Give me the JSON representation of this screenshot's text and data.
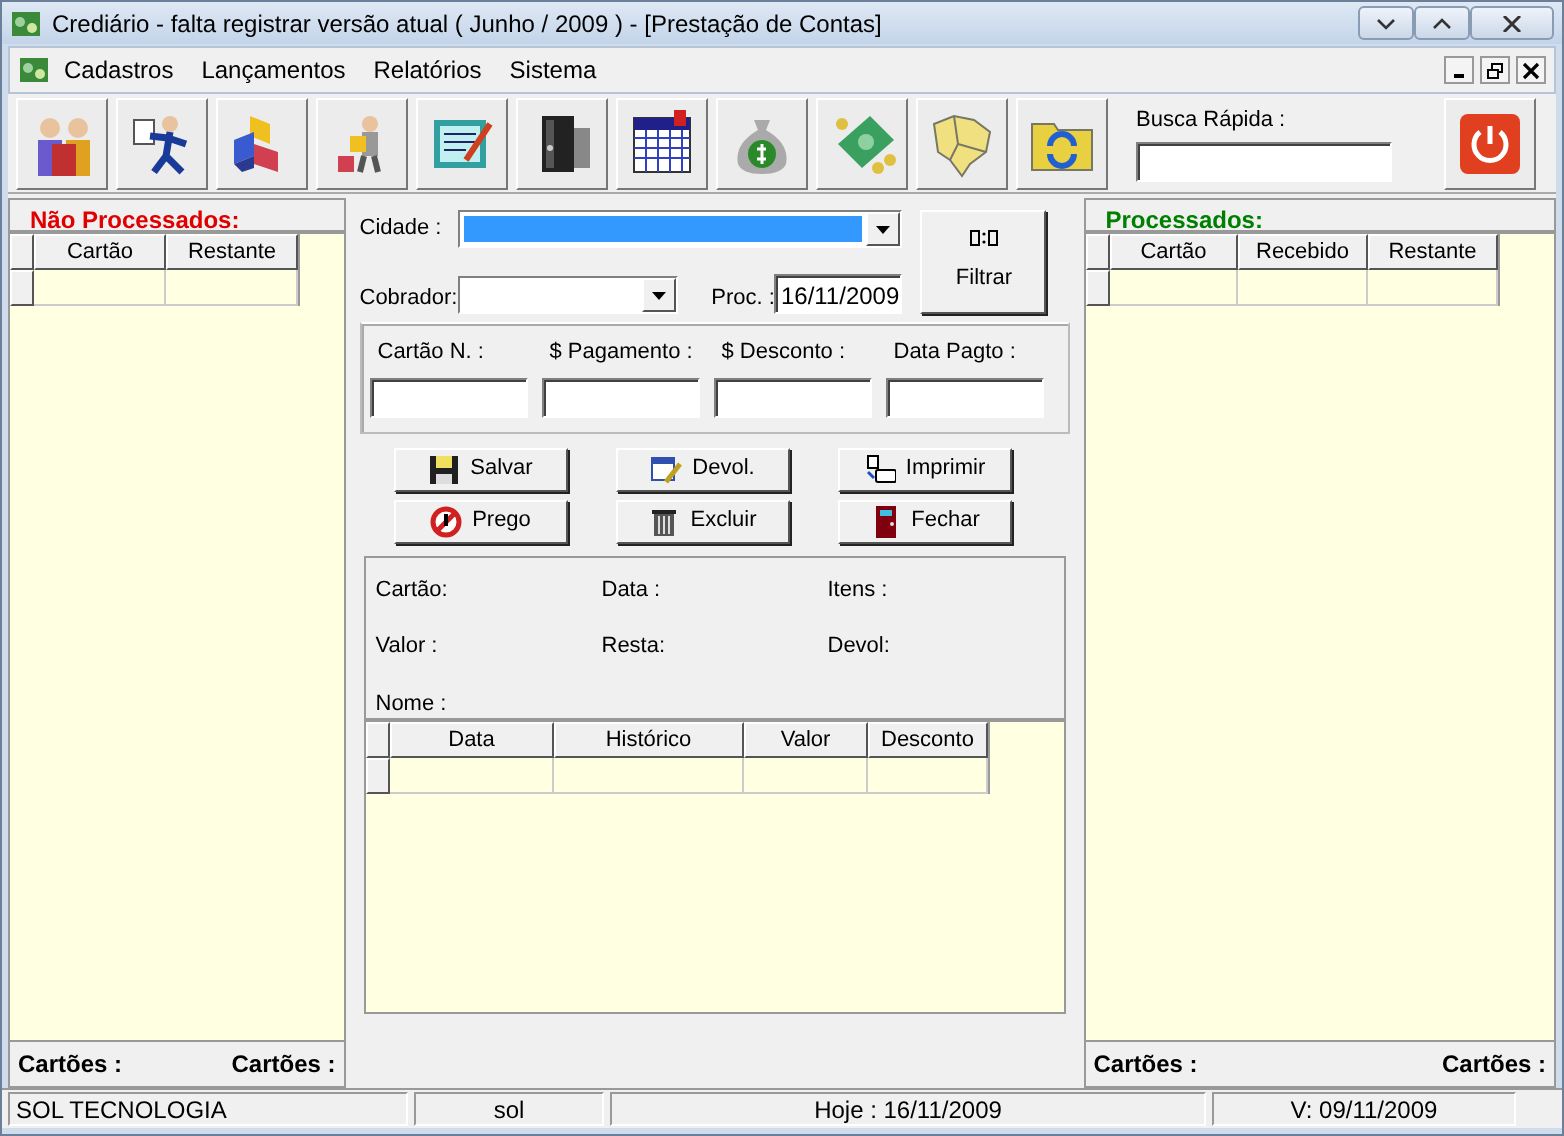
{
  "window": {
    "title": "Crediário - falta registrar versão atual ( Junho / 2009 ) - [Prestação de Contas]"
  },
  "menu": [
    "Cadastros",
    "Lançamentos",
    "Relatórios",
    "Sistema"
  ],
  "toolbar": [
    {
      "kind": "people"
    },
    {
      "kind": "runner"
    },
    {
      "kind": "cubes"
    },
    {
      "kind": "worker"
    },
    {
      "kind": "document"
    },
    {
      "kind": "binder"
    },
    {
      "kind": "calendar"
    },
    {
      "kind": "moneybag"
    },
    {
      "kind": "banknote"
    },
    {
      "kind": "map"
    },
    {
      "kind": "folder"
    }
  ],
  "quick_search": {
    "label": "Busca Rápida :"
  },
  "left_panel": {
    "title": "Não Processados:",
    "columns": [
      "Cartão",
      "Restante"
    ],
    "footer": [
      "Cartões :",
      "Cartões :"
    ]
  },
  "filters": {
    "city_label": "Cidade :",
    "collector_label": "Cobrador:",
    "proc_label": "Proc. :",
    "proc_value": "16/11/2009",
    "filter_button": "Filtrar"
  },
  "entry_fields": [
    {
      "label": "Cartão N. :"
    },
    {
      "label": "$ Pagamento :"
    },
    {
      "label": "$ Desconto :"
    },
    {
      "label": "Data Pagto :"
    }
  ],
  "actions": [
    {
      "kind": "save",
      "label": "Salvar"
    },
    {
      "kind": "edit",
      "label": "Devol."
    },
    {
      "kind": "print",
      "label": "Imprimir"
    },
    {
      "kind": "forbid",
      "label": "Prego"
    },
    {
      "kind": "trash",
      "label": "Excluir"
    },
    {
      "kind": "door",
      "label": "Fechar"
    }
  ],
  "info_labels": [
    [
      "Cartão:",
      "Data :",
      "Itens :"
    ],
    [
      "Valor :",
      "Resta:",
      "Devol:"
    ],
    [
      "Nome :"
    ]
  ],
  "detail_grid": {
    "columns": [
      "Data",
      "Histórico",
      "Valor",
      "Desconto"
    ]
  },
  "right_panel": {
    "title": "Processados:",
    "columns": [
      "Cartão",
      "Recebido",
      "Restante"
    ],
    "footer": [
      "Cartões :",
      "Cartões :"
    ]
  },
  "status_bar": [
    "SOL TECNOLOGIA",
    "sol",
    "Hoje : 16/11/2009",
    "V: 09/11/2009"
  ]
}
